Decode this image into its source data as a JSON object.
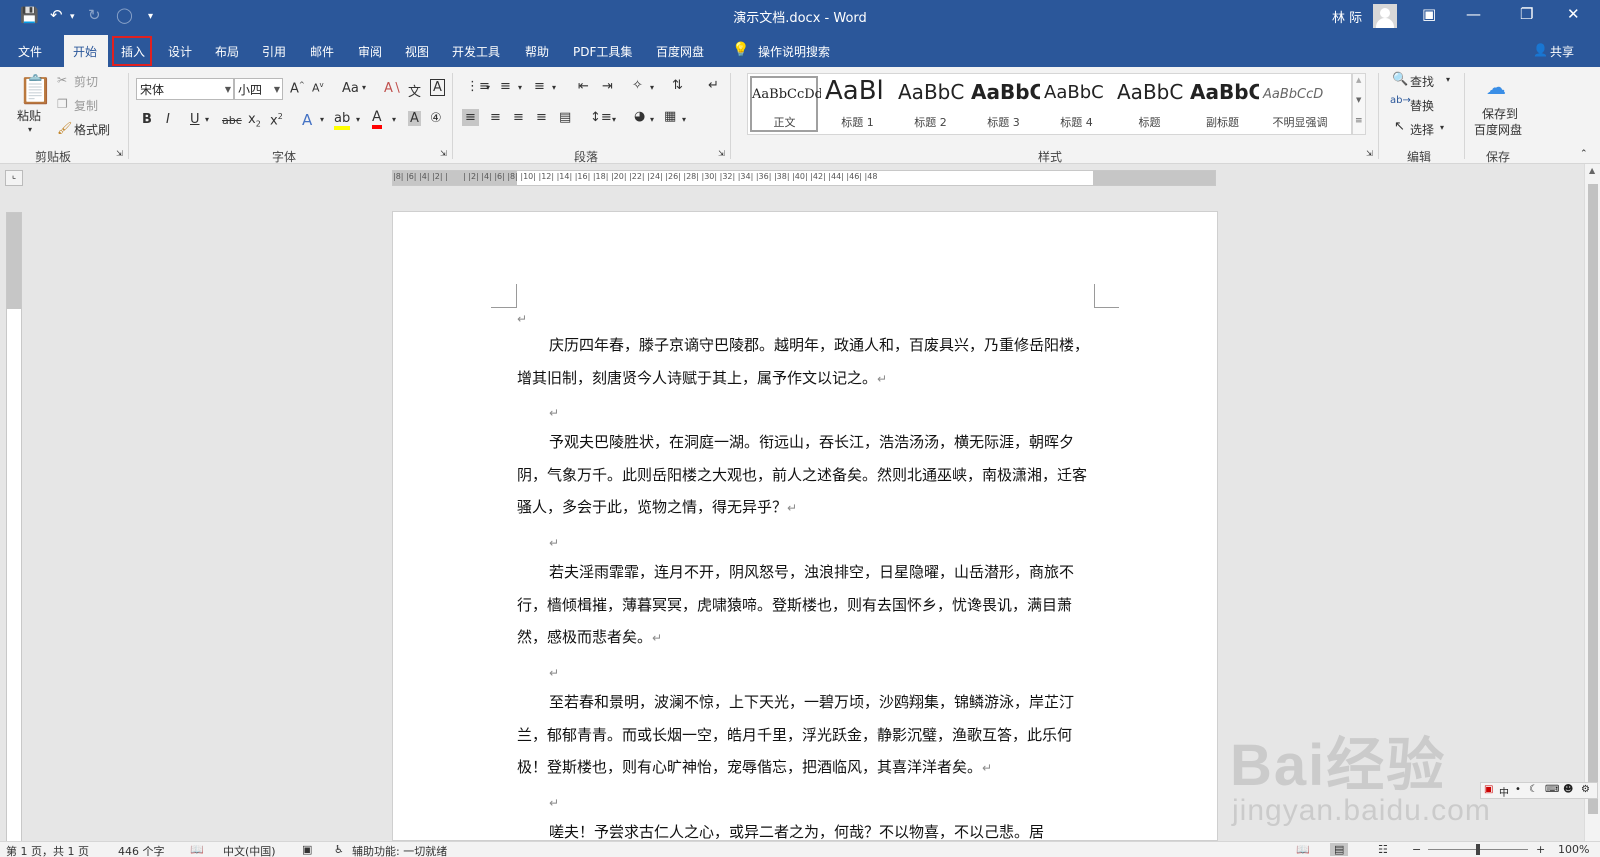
{
  "title_bar": {
    "doc_title": "演示文档.docx - Word",
    "user_name": "林 际",
    "icons": [
      "save-icon",
      "undo-icon",
      "redo-icon",
      "touch-mode-icon",
      "customize-icon"
    ]
  },
  "tabs": [
    "文件",
    "开始",
    "插入",
    "设计",
    "布局",
    "引用",
    "邮件",
    "审阅",
    "视图",
    "开发工具",
    "帮助",
    "PDF工具集",
    "百度网盘"
  ],
  "tell_me": "操作说明搜索",
  "share": "共享",
  "clipboard": {
    "paste": "粘贴",
    "cut": "剪切",
    "copy": "复制",
    "format_painter": "格式刷",
    "group": "剪贴板"
  },
  "font": {
    "name": "宋体",
    "size": "小四",
    "group": "字体",
    "change_case": "Aa"
  },
  "paragraph": {
    "group": "段落"
  },
  "styles": {
    "group": "样式",
    "items": [
      {
        "preview": "AaBbCcDd",
        "label": "正文"
      },
      {
        "preview": "AaBl",
        "label": "标题 1"
      },
      {
        "preview": "AaBbC",
        "label": "标题 2"
      },
      {
        "preview": "AaBbC",
        "label": "标题 3"
      },
      {
        "preview": "AaBbC",
        "label": "标题 4"
      },
      {
        "preview": "AaBbC",
        "label": "标题"
      },
      {
        "preview": "AaBbC",
        "label": "副标题"
      },
      {
        "preview": "AaBbCcD",
        "label": "不明显强调"
      }
    ]
  },
  "editing": {
    "find": "查找",
    "replace": "替换",
    "select": "选择",
    "group": "编辑"
  },
  "save": {
    "label1": "保存到",
    "label2": "百度网盘",
    "group": "保存"
  },
  "document": {
    "paragraphs": [
      "庆历四年春，滕子京谪守巴陵郡。越明年，政通人和，百废具兴，乃重修岳阳楼，增其旧制，刻唐贤今人诗赋于其上，属予作文以记之。",
      "予观夫巴陵胜状，在洞庭一湖。衔远山，吞长江，浩浩汤汤，横无际涯，朝晖夕阴，气象万千。此则岳阳楼之大观也，前人之述备矣。然则北通巫峡，南极潇湘，迁客骚人，多会于此，览物之情，得无异乎？",
      "若夫淫雨霏霏，连月不开，阴风怒号，浊浪排空，日星隐曜，山岳潜形，商旅不行，樯倾楫摧，薄暮冥冥，虎啸猿啼。登斯楼也，则有去国怀乡，忧谗畏讥，满目萧然，感极而悲者矣。",
      "至若春和景明，波澜不惊，上下天光，一碧万顷，沙鸥翔集，锦鳞游泳，岸芷汀兰，郁郁青青。而或长烟一空，皓月千里，浮光跃金，静影沉璧，渔歌互答，此乐何极！登斯楼也，则有心旷神怡，宠辱偕忘，把酒临风，其喜洋洋者矣。",
      "嗟夫！予尝求古仁人之心，或异二者之为，何哉？不以物喜，不以己悲。居"
    ],
    "para_mark": "↵"
  },
  "status": {
    "page": "第 1 页，共 1 页",
    "words": "446 个字",
    "lang": "中文(中国)",
    "accessibility": "辅助功能: 一切就绪",
    "zoom": "100%"
  },
  "watermark": {
    "logo": "Bai经验",
    "url": "jingyan.baidu.com"
  }
}
